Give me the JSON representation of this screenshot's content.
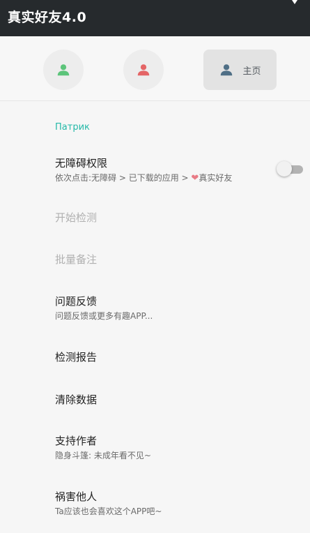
{
  "app_bar": {
    "title": "真实好友4.0"
  },
  "tabs": [
    {
      "icon": "person-icon",
      "color": "#5cc47a"
    },
    {
      "icon": "person-icon",
      "color": "#e46566"
    },
    {
      "icon": "person-icon",
      "color": "#4f6f86",
      "label": "主页",
      "selected": true
    }
  ],
  "section": {
    "header": "Патрик"
  },
  "settings": {
    "accessibility": {
      "title": "无障碍权限",
      "subtitle_prefix": "依次点击:无障碍 > 已下载的应用 > ",
      "subtitle_suffix": "真实好友",
      "heart_icon": "heart-icon",
      "toggle_on": false
    },
    "start_detect": {
      "title": "开始检测",
      "enabled": false
    },
    "batch_note": {
      "title": "批量备注",
      "enabled": false
    },
    "feedback": {
      "title": "问题反馈",
      "subtitle": "问题反馈或更多有趣APP..."
    },
    "report": {
      "title": "检测报告"
    },
    "clear_data": {
      "title": "清除数据"
    },
    "support": {
      "title": "支持作者",
      "subtitle": "隐身斗篷: 未成年看不见~"
    },
    "share": {
      "title": "祸害他人",
      "subtitle": "Ta应该也会喜欢这个APP吧~"
    }
  },
  "colors": {
    "accent": "#24b9a8",
    "app_bar": "#262a2d"
  }
}
